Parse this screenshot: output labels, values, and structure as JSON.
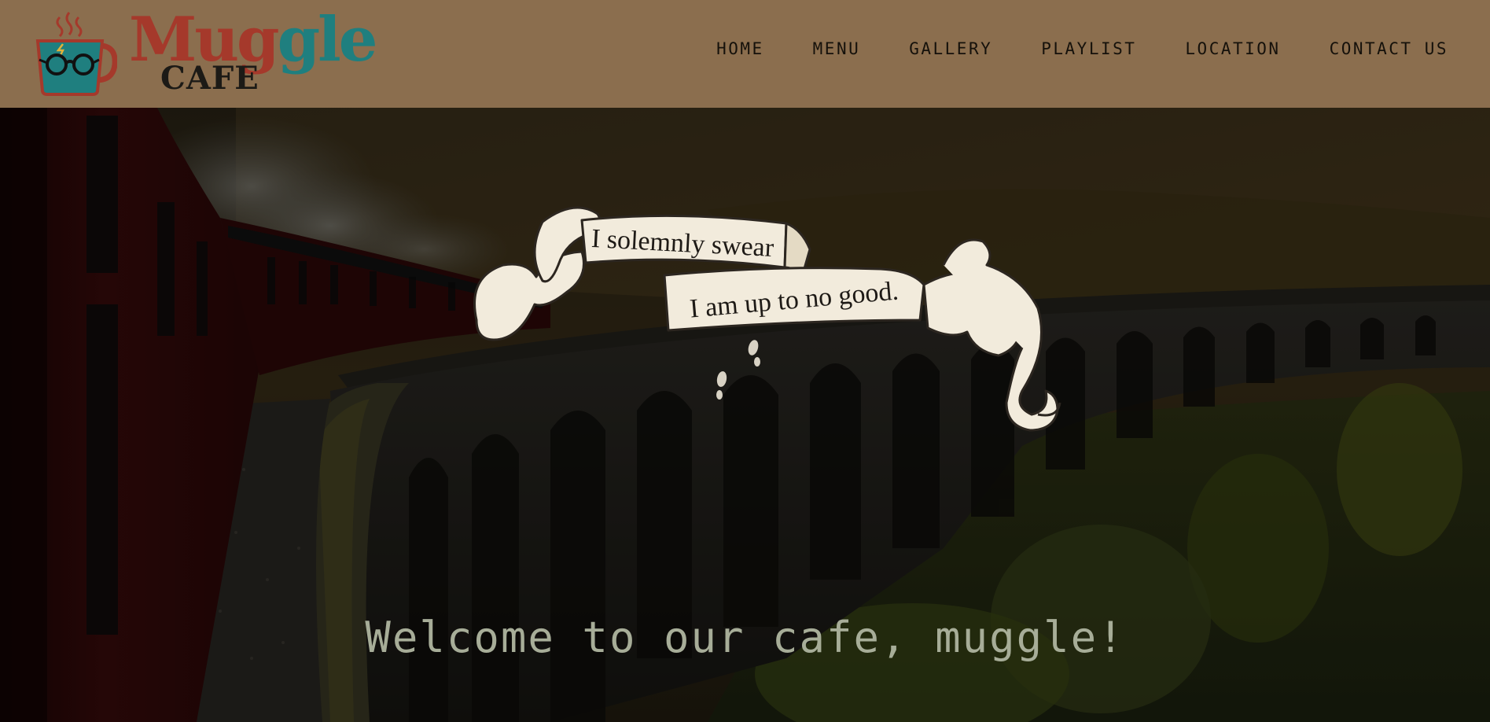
{
  "brand": {
    "name_part_a": "Mug",
    "name_part_b": "gle",
    "sub": "CAFE",
    "icon": "coffee-cup-glasses-icon",
    "colors": {
      "header_bg": "#8b6e4e",
      "brand_red": "#a5392b",
      "brand_teal": "#1f7f7f",
      "text_dark": "#15110b"
    }
  },
  "nav": {
    "items": [
      {
        "label": "HOME"
      },
      {
        "label": "MENU"
      },
      {
        "label": "GALLERY"
      },
      {
        "label": "PLAYLIST"
      },
      {
        "label": "LOCATION"
      },
      {
        "label": "CONTACT US"
      }
    ]
  },
  "hero": {
    "banner_line1": "I solemnly swear",
    "banner_line2": "I am up to no good.",
    "welcome": "Welcome to our cafe, muggle!",
    "welcome_color": "#a7ad98"
  }
}
